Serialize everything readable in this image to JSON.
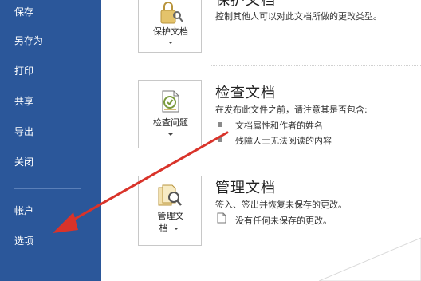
{
  "sidebar": {
    "items": [
      {
        "label": "保存"
      },
      {
        "label": "另存为"
      },
      {
        "label": "打印"
      },
      {
        "label": "共享"
      },
      {
        "label": "导出"
      },
      {
        "label": "关闭"
      },
      {
        "label": "帐户"
      },
      {
        "label": "选项"
      }
    ],
    "bg_color": "#2b579a"
  },
  "sections": {
    "protect": {
      "button_label": "保护文档",
      "title": "保护文档",
      "description": "控制其他人可以对此文档所做的更改类型。"
    },
    "inspect": {
      "button_label": "检查问题",
      "title": "检查文档",
      "description": "在发布此文件之前，请注意其是否包含:",
      "bullets": [
        "文档属性和作者的姓名",
        "残障人士无法阅读的内容"
      ]
    },
    "manage": {
      "button_label_line1": "管理文",
      "button_label_line2": "档",
      "title": "管理文档",
      "description": "签入、签出并恢复未保存的更改。",
      "note": "没有任何未保存的更改。"
    }
  },
  "annotation": {
    "arrow_color": "#d9332a",
    "arrow_target": "sidebar-item-options"
  }
}
